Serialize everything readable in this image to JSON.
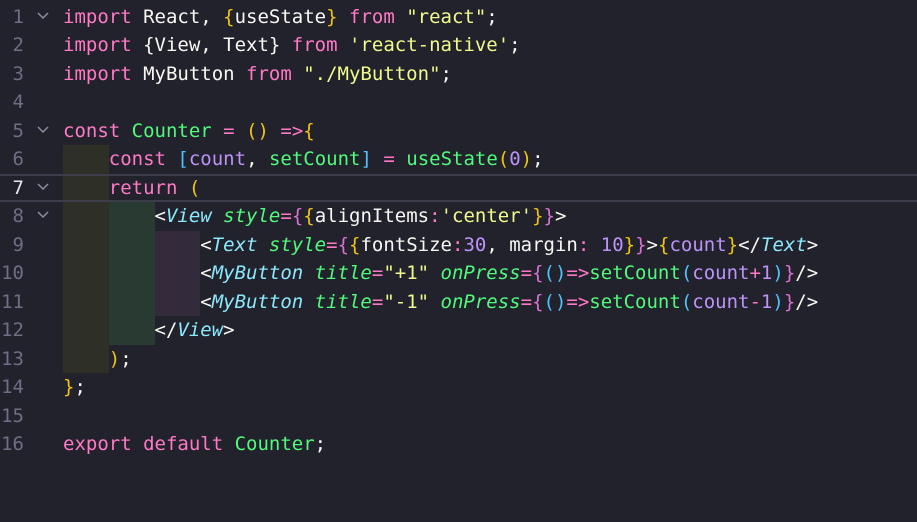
{
  "theme": {
    "background": "#22222c",
    "keyword": "#ff79c6",
    "plain": "#f8f8f2",
    "string": "#f1fa8c",
    "variable": "#bd93f9",
    "tag": "#8be9fd",
    "attr": "#50fa7b",
    "bracket_gold": "#f1c40f",
    "bracket_pink": "#da70d6",
    "bracket_blue": "#4fc1ff",
    "number": "#bd93f9"
  },
  "lines": [
    {
      "number": "1",
      "fold": true,
      "tokens": [
        {
          "t": "import",
          "c": "#ff79c6"
        },
        {
          "t": " React, ",
          "c": "#f8f8f2"
        },
        {
          "t": "{",
          "c": "#f1c40f"
        },
        {
          "t": "useState",
          "c": "#f8f8f2"
        },
        {
          "t": "}",
          "c": "#f1c40f"
        },
        {
          "t": " from ",
          "c": "#ff79c6"
        },
        {
          "t": "\"react\"",
          "c": "#f1fa8c"
        },
        {
          "t": ";",
          "c": "#f8f8f2"
        }
      ]
    },
    {
      "number": "2",
      "fold": false,
      "tokens": [
        {
          "t": "import",
          "c": "#ff79c6"
        },
        {
          "t": " {View, Text}",
          "c": "#f8f8f2"
        },
        {
          "t": " from ",
          "c": "#ff79c6"
        },
        {
          "t": "'react-native'",
          "c": "#f1fa8c"
        },
        {
          "t": ";",
          "c": "#f8f8f2"
        }
      ]
    },
    {
      "number": "3",
      "fold": false,
      "tokens": [
        {
          "t": "import",
          "c": "#ff79c6"
        },
        {
          "t": " MyButton",
          "c": "#f8f8f2"
        },
        {
          "t": " from ",
          "c": "#ff79c6"
        },
        {
          "t": "\"./MyButton\"",
          "c": "#f1fa8c"
        },
        {
          "t": ";",
          "c": "#f8f8f2"
        }
      ]
    },
    {
      "number": "4",
      "fold": false,
      "tokens": []
    },
    {
      "number": "5",
      "fold": true,
      "tokens": [
        {
          "t": "const",
          "c": "#ff79c6"
        },
        {
          "t": " Counter",
          "c": "#50fa7b"
        },
        {
          "t": " = ",
          "c": "#ff79c6"
        },
        {
          "t": "()",
          "c": "#f1c40f"
        },
        {
          "t": " =>",
          "c": "#ff79c6"
        },
        {
          "t": "{",
          "c": "#f1c40f"
        }
      ]
    },
    {
      "number": "6",
      "fold": false,
      "tokens": [
        {
          "t": "    ",
          "c": "#f8f8f2"
        },
        {
          "t": "const",
          "c": "#ff79c6"
        },
        {
          "t": " [",
          "c": "#4fc1ff"
        },
        {
          "t": "count",
          "c": "#bd93f9"
        },
        {
          "t": ", ",
          "c": "#f8f8f2"
        },
        {
          "t": "setCount",
          "c": "#50fa7b"
        },
        {
          "t": "]",
          "c": "#4fc1ff"
        },
        {
          "t": " = ",
          "c": "#ff79c6"
        },
        {
          "t": "useState",
          "c": "#50fa7b"
        },
        {
          "t": "(",
          "c": "#f1c40f"
        },
        {
          "t": "0",
          "c": "#bd93f9"
        },
        {
          "t": ")",
          "c": "#f1c40f"
        },
        {
          "t": ";",
          "c": "#f8f8f2"
        }
      ]
    },
    {
      "number": "7",
      "fold": true,
      "active": true,
      "tokens": [
        {
          "t": "    ",
          "c": "#f8f8f2"
        },
        {
          "t": "return",
          "c": "#ff79c6"
        },
        {
          "t": " (",
          "c": "#f1c40f"
        }
      ]
    },
    {
      "number": "8",
      "fold": true,
      "tokens": [
        {
          "t": "        <",
          "c": "#f8f8f2"
        },
        {
          "t": "View",
          "c": "#8be9fd",
          "i": true
        },
        {
          "t": " style",
          "c": "#50fa7b",
          "i": true
        },
        {
          "t": "=",
          "c": "#ff79c6"
        },
        {
          "t": "{",
          "c": "#da70d6"
        },
        {
          "t": "{",
          "c": "#f1c40f"
        },
        {
          "t": "alignItems",
          "c": "#f8f8f2"
        },
        {
          "t": ":",
          "c": "#ff79c6"
        },
        {
          "t": "'center'",
          "c": "#f1fa8c"
        },
        {
          "t": "}",
          "c": "#f1c40f"
        },
        {
          "t": "}",
          "c": "#da70d6"
        },
        {
          "t": ">",
          "c": "#f8f8f2"
        }
      ]
    },
    {
      "number": "9",
      "fold": false,
      "tokens": [
        {
          "t": "            <",
          "c": "#f8f8f2"
        },
        {
          "t": "Text",
          "c": "#8be9fd",
          "i": true
        },
        {
          "t": " style",
          "c": "#50fa7b",
          "i": true
        },
        {
          "t": "=",
          "c": "#ff79c6"
        },
        {
          "t": "{",
          "c": "#da70d6"
        },
        {
          "t": "{",
          "c": "#f1c40f"
        },
        {
          "t": "fontSize",
          "c": "#f8f8f2"
        },
        {
          "t": ":",
          "c": "#ff79c6"
        },
        {
          "t": "30",
          "c": "#bd93f9"
        },
        {
          "t": ", margin",
          "c": "#f8f8f2"
        },
        {
          "t": ": ",
          "c": "#ff79c6"
        },
        {
          "t": "10",
          "c": "#bd93f9"
        },
        {
          "t": "}",
          "c": "#f1c40f"
        },
        {
          "t": "}",
          "c": "#da70d6"
        },
        {
          "t": ">",
          "c": "#f8f8f2"
        },
        {
          "t": "{",
          "c": "#f1c40f"
        },
        {
          "t": "count",
          "c": "#bd93f9"
        },
        {
          "t": "}",
          "c": "#f1c40f"
        },
        {
          "t": "</",
          "c": "#f8f8f2"
        },
        {
          "t": "Text",
          "c": "#8be9fd",
          "i": true
        },
        {
          "t": ">",
          "c": "#f8f8f2"
        }
      ]
    },
    {
      "number": "10",
      "fold": false,
      "tokens": [
        {
          "t": "            <",
          "c": "#f8f8f2"
        },
        {
          "t": "MyButton",
          "c": "#8be9fd",
          "i": true
        },
        {
          "t": " title",
          "c": "#50fa7b",
          "i": true
        },
        {
          "t": "=",
          "c": "#ff79c6"
        },
        {
          "t": "\"+1\"",
          "c": "#f1fa8c"
        },
        {
          "t": " onPress",
          "c": "#50fa7b",
          "i": true
        },
        {
          "t": "=",
          "c": "#ff79c6"
        },
        {
          "t": "{",
          "c": "#da70d6"
        },
        {
          "t": "()",
          "c": "#4fc1ff"
        },
        {
          "t": "=>",
          "c": "#ff79c6"
        },
        {
          "t": "setCount",
          "c": "#50fa7b"
        },
        {
          "t": "(",
          "c": "#4fc1ff"
        },
        {
          "t": "count",
          "c": "#bd93f9"
        },
        {
          "t": "+",
          "c": "#ff79c6"
        },
        {
          "t": "1",
          "c": "#bd93f9"
        },
        {
          "t": ")",
          "c": "#4fc1ff"
        },
        {
          "t": "}",
          "c": "#da70d6"
        },
        {
          "t": "/>",
          "c": "#f8f8f2"
        }
      ]
    },
    {
      "number": "11",
      "fold": false,
      "tokens": [
        {
          "t": "            <",
          "c": "#f8f8f2"
        },
        {
          "t": "MyButton",
          "c": "#8be9fd",
          "i": true
        },
        {
          "t": " title",
          "c": "#50fa7b",
          "i": true
        },
        {
          "t": "=",
          "c": "#ff79c6"
        },
        {
          "t": "\"-1\"",
          "c": "#f1fa8c"
        },
        {
          "t": " onPress",
          "c": "#50fa7b",
          "i": true
        },
        {
          "t": "=",
          "c": "#ff79c6"
        },
        {
          "t": "{",
          "c": "#da70d6"
        },
        {
          "t": "()",
          "c": "#4fc1ff"
        },
        {
          "t": "=>",
          "c": "#ff79c6"
        },
        {
          "t": "setCount",
          "c": "#50fa7b"
        },
        {
          "t": "(",
          "c": "#4fc1ff"
        },
        {
          "t": "count",
          "c": "#bd93f9"
        },
        {
          "t": "-",
          "c": "#ff79c6"
        },
        {
          "t": "1",
          "c": "#bd93f9"
        },
        {
          "t": ")",
          "c": "#4fc1ff"
        },
        {
          "t": "}",
          "c": "#da70d6"
        },
        {
          "t": "/>",
          "c": "#f8f8f2"
        }
      ]
    },
    {
      "number": "12",
      "fold": false,
      "tokens": [
        {
          "t": "        </",
          "c": "#f8f8f2"
        },
        {
          "t": "View",
          "c": "#8be9fd",
          "i": true
        },
        {
          "t": ">",
          "c": "#f8f8f2"
        }
      ]
    },
    {
      "number": "13",
      "fold": false,
      "tokens": [
        {
          "t": "    ",
          "c": "#f8f8f2"
        },
        {
          "t": ")",
          "c": "#f1c40f"
        },
        {
          "t": ";",
          "c": "#f8f8f2"
        }
      ]
    },
    {
      "number": "14",
      "fold": false,
      "tokens": [
        {
          "t": "}",
          "c": "#f1c40f"
        },
        {
          "t": ";",
          "c": "#f8f8f2"
        }
      ]
    },
    {
      "number": "15",
      "fold": false,
      "tokens": []
    },
    {
      "number": "16",
      "fold": false,
      "tokens": [
        {
          "t": "export",
          "c": "#ff79c6"
        },
        {
          "t": " default",
          "c": "#ff79c6"
        },
        {
          "t": " Counter",
          "c": "#50fa7b"
        },
        {
          "t": ";",
          "c": "#f8f8f2"
        }
      ]
    }
  ]
}
